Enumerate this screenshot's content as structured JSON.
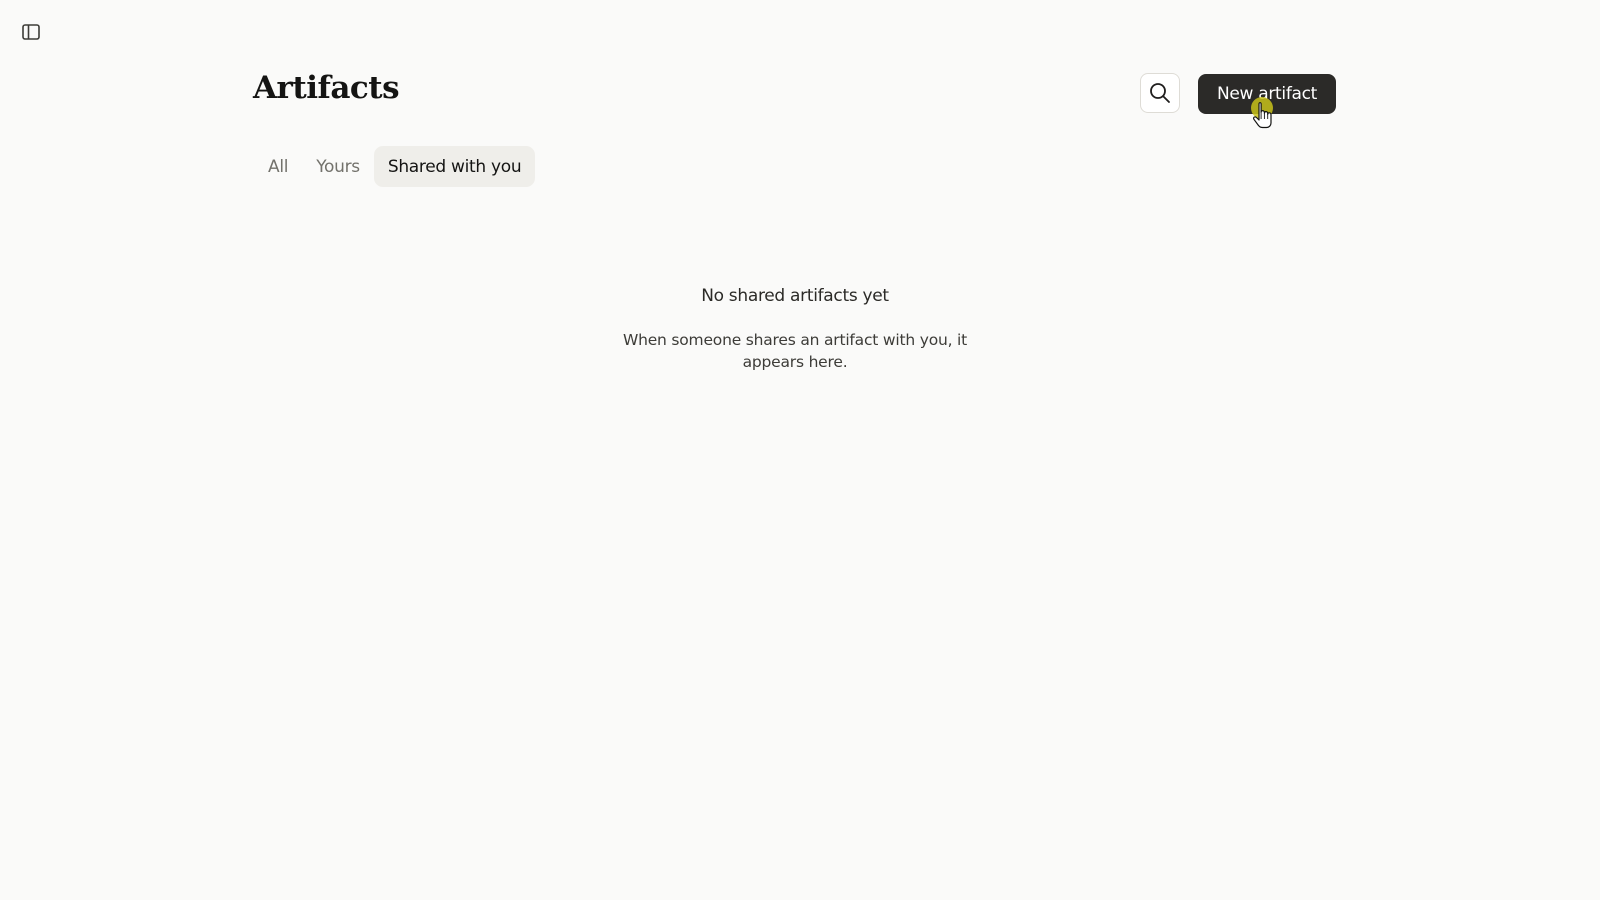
{
  "page": {
    "title": "Artifacts"
  },
  "header": {
    "sidebar_toggle_icon": "sidebar-panel-icon",
    "search_icon": "search-icon",
    "new_artifact_label": "New artifact"
  },
  "tabs": [
    {
      "label": "All",
      "active": false
    },
    {
      "label": "Yours",
      "active": false
    },
    {
      "label": "Shared with you",
      "active": true
    }
  ],
  "empty_state": {
    "title": "No shared artifacts yet",
    "description": "When someone shares an artifact with you, it appears here."
  },
  "colors": {
    "background": "#fafaf9",
    "primary_button": "#2b2a28",
    "active_tab_bg": "#efeeea",
    "cursor_highlight": "#c8c21a"
  }
}
